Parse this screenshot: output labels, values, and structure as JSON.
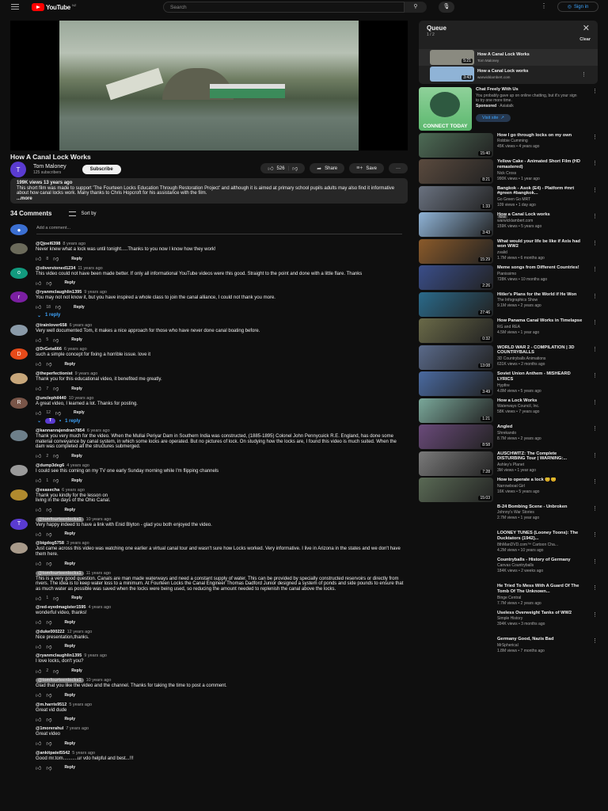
{
  "header": {
    "logo": "YouTube",
    "region": "NZ",
    "search_placeholder": "Search",
    "sign_in": "Sign in"
  },
  "video": {
    "title": "How A Canal Lock Works",
    "channel": "Tom Maloney",
    "channel_initial": "T",
    "subscribers": "125 subscribers",
    "subscribe": "Subscribe",
    "likes": "526",
    "share": "Share",
    "save": "Save",
    "views_date": "199K views  13 years ago",
    "description": "This short film was made to support 'The Fourteen Locks Education Through Restoration Project' and although it is aimed at primary school pupils adults may also find it informative about how canal locks work. Many thanks to Chris Hopcroft for his assistance with the film.",
    "more": "...more"
  },
  "comments_header": {
    "count": "34 Comments",
    "sort": "Sort by",
    "add_placeholder": "Add a comment..."
  },
  "comments": [
    {
      "user": "@Qjoel6398",
      "time": "8 years ago",
      "text": "Never knew what a lock was until tonight.....Thanks to you now I know how they work!",
      "likes": "8",
      "avatar_color": "#6b6a5a",
      "initial": ""
    },
    {
      "user": "@oliverstoned1234",
      "time": "11 years ago",
      "text": "This video could not have been made better. If only all informational YouTube videos were this good. Straight to the point and done with a little flare. Thanks",
      "likes": "",
      "avatar_color": "#129a7e",
      "initial": "o"
    },
    {
      "user": "@ryanmclaughlin1395",
      "time": "9 years ago",
      "text": "You may not not know it, but you have inspired a whole class to join the canal alliance, I could not thank you more.",
      "likes": "18",
      "avatar_color": "#7b1fa2",
      "initial": "r",
      "replies": "1 reply"
    },
    {
      "user": "@trainlover658",
      "time": "6 years ago",
      "text": "Very well documented Tom, it makes a nice approach for those who have never done canal boating before.",
      "likes": "5",
      "avatar_color": "#8a9aa8",
      "initial": ""
    },
    {
      "user": "@DrGeta666",
      "time": "6 years ago",
      "text": "such a simple concept for fixing a horrible issue. love it",
      "likes": "",
      "avatar_color": "#e64a19",
      "initial": "D"
    },
    {
      "user": "@theperfectionist",
      "time": "9 years ago",
      "text": "Thank you for this educational video, it benefited me greatly.",
      "likes": "7",
      "avatar_color": "#c7a67a",
      "initial": ""
    },
    {
      "user": "@unclephil440",
      "time": "10 years ago",
      "text": "A great video, I learned a lot. Thanks for posting.",
      "likes": "12",
      "avatar_color": "#795548",
      "initial": "R",
      "replies": "1 reply",
      "reply_avatar": "T"
    },
    {
      "user": "@kannanrajendran7854",
      "time": "6 years ago",
      "text": "Thank you very much for the video. When the Mullai Periyar Dam in Southern India was constructed, (1885-1895) Colonel John Pennycuick R.E. England, has done some material conveyance by canal system, in which some locks are operated. But no pictures of lock. On studying how the locks are, I found this video is much suited. When the dam was completed all the structures submerged.",
      "likes": "2",
      "avatar_color": "#6d7f8a",
      "initial": ""
    },
    {
      "user": "@dump3deg6",
      "time": "4 years ago",
      "text": "I could see this coming on my TV one early Sunday morning while I'm flipping channels",
      "likes": "1",
      "avatar_color": "#9a9a9a",
      "initial": ""
    },
    {
      "user": "@esasecha",
      "time": "6 years ago",
      "text": "Thank you kindly for the lesson on\nliving in the days of the Ohio Canal.",
      "likes": "",
      "avatar_color": "#b08a2e",
      "initial": ""
    },
    {
      "user": "@tomfourteenlocks1",
      "time": "10 years ago",
      "text": "Very happy indeed to have a link with Enid Blyton - glad you both enjoyed the video.",
      "likes": "",
      "avatar_color": "#5a3bd1",
      "initial": "T",
      "owner": true
    },
    {
      "user": "@bigdog5758",
      "time": "3 years ago",
      "text": "Just came across this video was watching one earlier a virtual canal tour and wasn't sure how Locks worked. Very informative. I live in Arizona in the states and we don't have them here.",
      "likes": "",
      "avatar_color": "#a89a8a",
      "initial": ""
    },
    {
      "user": "@tomfourteenlocks1",
      "time": "11 years ago",
      "text": "This is a very good question. Canals are man made waterways and need a constant supply of water. This can be provided by specially constructed reservoirs or directly from rivers. The idea is to keep water loss to a minimum. At Fourteen Locks the Canal Engineer Thomas Dadford Junior designed a system of ponds and side pounds to ensure that as much water as possible was saved when the locks were being used, so reducing the amount needed to replenish the canal above the locks.",
      "likes": "1",
      "owner": true
    },
    {
      "user": "@red-eyedmagister1595",
      "time": "4 years ago",
      "text": "wonderful video, thanks!",
      "likes": ""
    },
    {
      "user": "@duke000222",
      "time": "12 years ago",
      "text": "Nice presentation,thanks.",
      "likes": ""
    },
    {
      "user": "@ryanmclaughlin1395",
      "time": "9 years ago",
      "text": "I love locks, don't you?",
      "likes": "2"
    },
    {
      "user": "@tomfourteenlocks1",
      "time": "10 years ago",
      "text": "Glad that you like the video and the channel. Thanks for taking the time to post a comment.",
      "likes": "",
      "owner": true
    },
    {
      "user": "@m.harris9512",
      "time": "5 years ago",
      "text": "Great vid dude",
      "likes": ""
    },
    {
      "user": "@1morerahul",
      "time": "7 years ago",
      "text": "Great video",
      "likes": ""
    },
    {
      "user": "@ankitpatel5542",
      "time": "5 years ago",
      "text": "Good mr.tom...........ur vdo helpful and best...!!!",
      "likes": ""
    }
  ],
  "reply_label": "Reply",
  "queue": {
    "title": "Queue",
    "count": "1 / 2",
    "clear": "Clear",
    "items": [
      {
        "title": "How A Canal Lock Works",
        "channel": "Tom Maloney",
        "duration": "5:21",
        "color": "#8a8a80"
      },
      {
        "title": "How a Canal Lock works",
        "channel": "warwicklambert.com",
        "duration": "3:43",
        "color": "#8fb3d6"
      }
    ]
  },
  "ad": {
    "title": "Chat Freely With Us",
    "text": "You probably gave up on online chatting, but it's your sign to try one more time.",
    "sponsored": "Sponsored",
    "advertiser": "Asiatalk",
    "cta": "Visit site",
    "banner": "CONNECT TODAY"
  },
  "recommendations": [
    {
      "title": "How I go through locks on my own",
      "channel": "Robbie Cumming",
      "meta": "45K views • 4 years ago",
      "duration": "15:40",
      "color": "#4d6b55"
    },
    {
      "title": "Yellow Cake - Animated Short Film (HD remastered)",
      "channel": "Nick Cross",
      "meta": "990K views • 1 year ago",
      "duration": "8:21",
      "color": "#5a4a3e"
    },
    {
      "title": "Bangkok - Asok (E4) - Platform #mrt #green #bangkok...",
      "channel": "Go Green Go MRT",
      "meta": "109 views • 1 day ago",
      "duration": "1:33",
      "color": "#6a7280",
      "badge": "New"
    },
    {
      "title": "How a Canal Lock works",
      "channel": "warwicklambert.com",
      "meta": "159K views • 5 years ago",
      "duration": "3:43",
      "color": "#8fb3d6"
    },
    {
      "title": "What would your life be like if Axis had won WW2",
      "channel": "zvalid",
      "meta": "1.7M views • 6 months ago",
      "duration": "15:29",
      "color": "#8a5a2a"
    },
    {
      "title": "Meme songs from Different Countries!",
      "channel": "Pianissimo",
      "meta": "728K views • 10 months ago",
      "duration": "2:26",
      "color": "#3a4e8a"
    },
    {
      "title": "Hitler's Plans for the World if He Won",
      "channel": "The Infographics Show",
      "meta": "9.1M views • 2 years ago",
      "duration": "27:46",
      "color": "#2a6a8a"
    },
    {
      "title": "How Panama Canal Works in Timelapse",
      "channel": "RG and REA",
      "meta": "4.5M views • 1 year ago",
      "duration": "0:32",
      "color": "#6a6a48"
    },
    {
      "title": "WORLD WAR 2 - COMPILATION | 3D COUNTRYBALLS",
      "channel": "3D Countryballs Animations",
      "meta": "631K views • 2 months ago",
      "duration": "13:08",
      "color": "#5a6a8a"
    },
    {
      "title": "Soviet Union Anthem - MISHEARD LYRICS",
      "channel": "Hypfire",
      "meta": "4.8M views • 5 years ago",
      "duration": "3:49",
      "color": "#4a6aa0"
    },
    {
      "title": "How a Lock Works",
      "channel": "Waterways Council, Inc.",
      "meta": "58K views • 7 years ago",
      "duration": "1:21",
      "color": "#7aa89a"
    },
    {
      "title": "Angled",
      "channel": "Shrekando",
      "meta": "8.7M views • 2 years ago",
      "duration": "8:58",
      "color": "#6a4a7a"
    },
    {
      "title": "AUSCHWITZ: The Complete DISTURBING Tour | WARNING:...",
      "channel": "Ashley's Planet",
      "meta": "3M views • 1 year ago",
      "duration": "7:28",
      "color": "#7a7a7a"
    },
    {
      "title": "How to operate a lock 😊😊",
      "channel": "Narrowboat Girl",
      "meta": "16K views • 5 years ago",
      "duration": "15:03",
      "color": "#5a6a55"
    },
    {
      "title": "B-24 Bombing Scene - Unbroken",
      "channel": "Johnny's War Stories",
      "meta": "2.7M views • 1 year ago"
    },
    {
      "title": "LOONEY TUNES (Looney Toons): The Ducktators (1942)...",
      "channel": "8thManDVD.com™ Cartoon Cha...",
      "meta": "4.2M views • 10 years ago"
    },
    {
      "title": "Countryballs - History of Germany",
      "channel": "Canvas Countryballs",
      "meta": "184K views • 2 weeks ago"
    },
    {
      "title": "He Tried To Mess With A Guard Of The Tomb Of The Unknown...",
      "channel": "Binge Central",
      "meta": "7.7M views • 2 years ago"
    },
    {
      "title": "Useless Overweight Tanks of WW2",
      "channel": "Simple History",
      "meta": "394K views • 3 months ago"
    },
    {
      "title": "Germany Good, Nazis Bad",
      "channel": "MrSpherical",
      "meta": "1.8M views • 7 months ago"
    }
  ]
}
